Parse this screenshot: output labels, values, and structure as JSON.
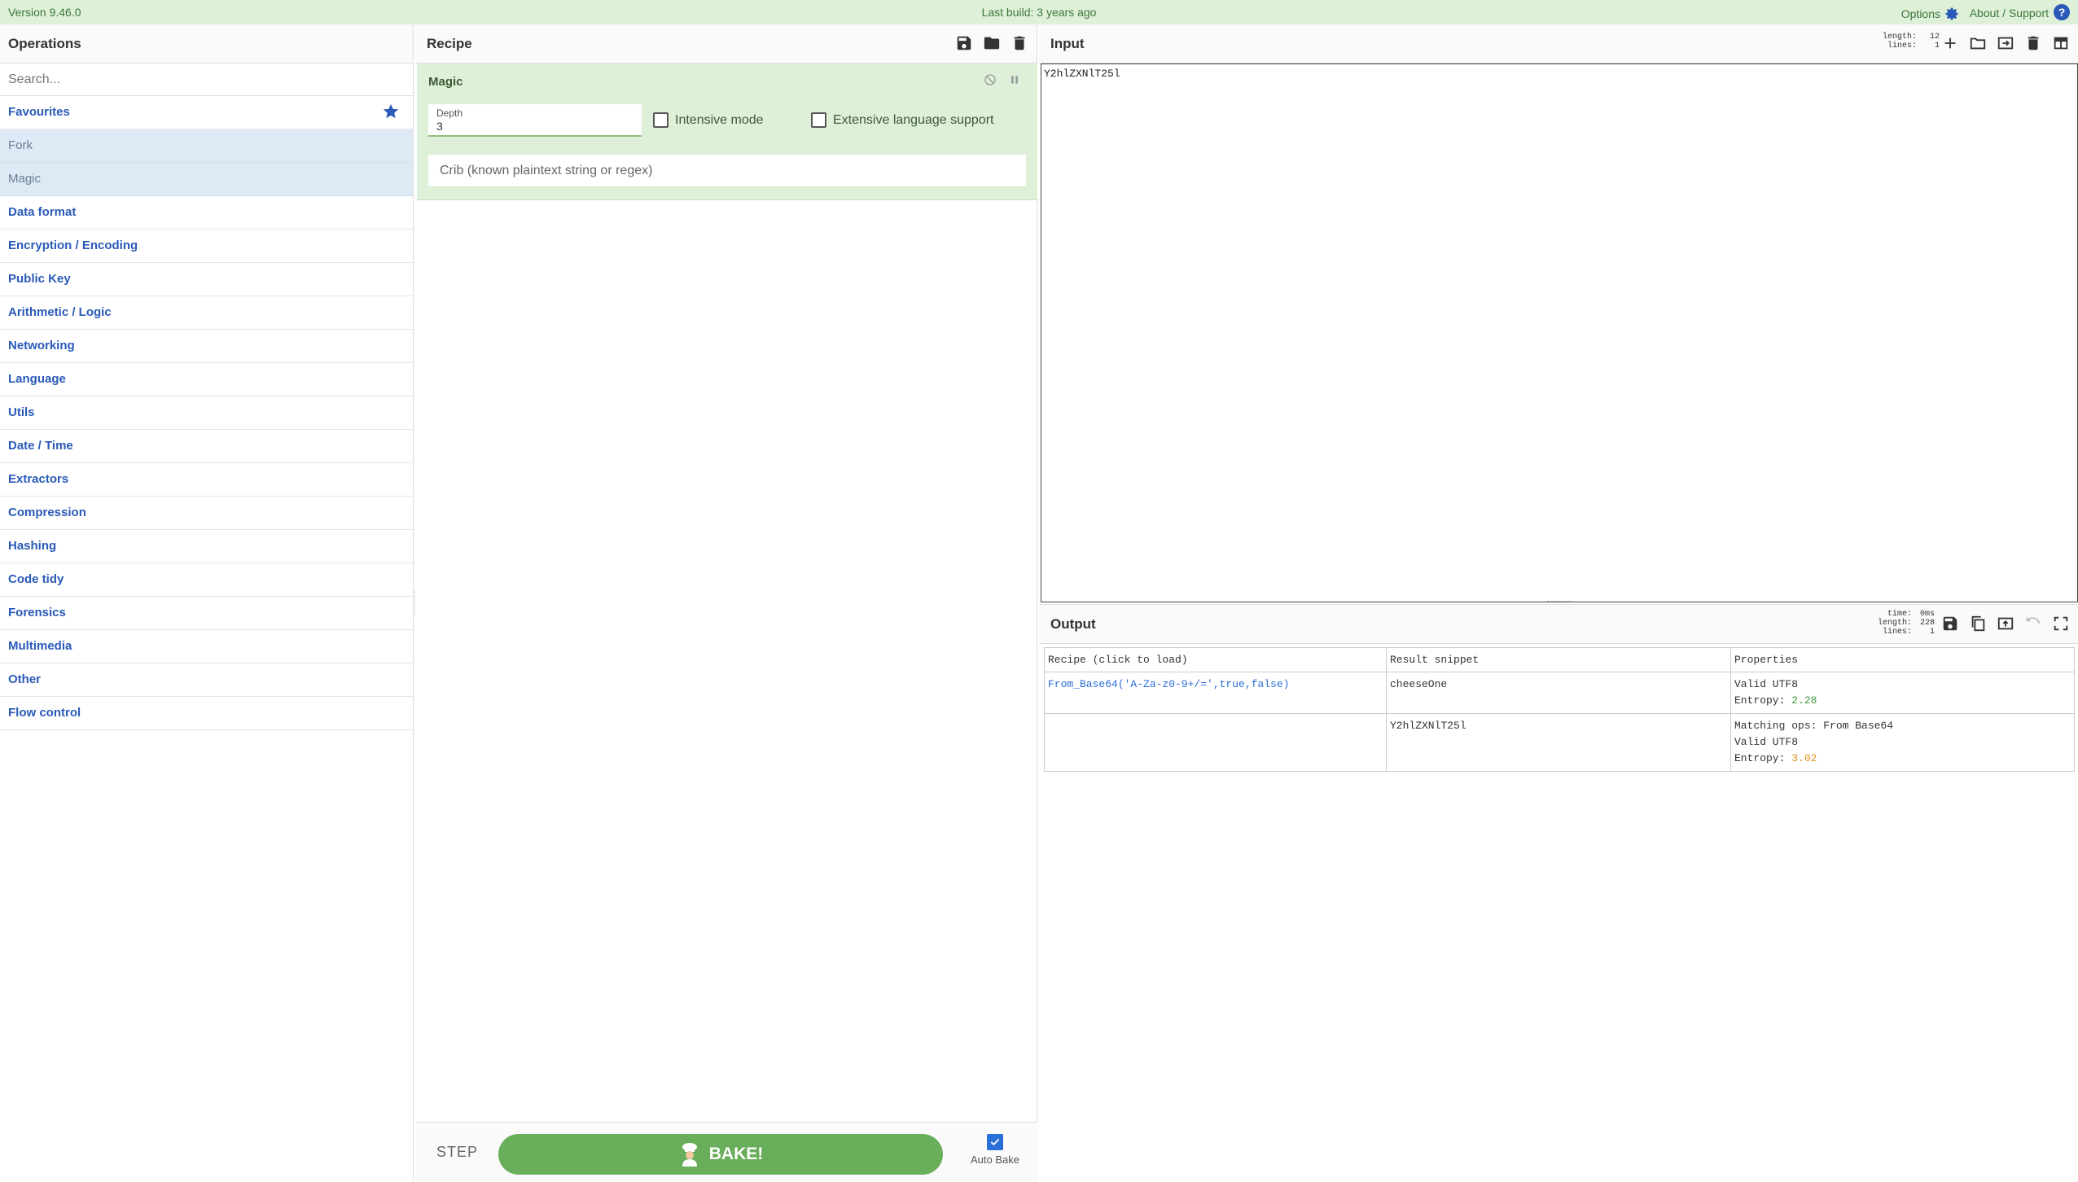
{
  "banner": {
    "version": "Version 9.46.0",
    "last_build": "Last build: 3 years ago",
    "options": "Options",
    "about": "About / Support",
    "bg_color": "#dff0d8"
  },
  "operations": {
    "title": "Operations",
    "search_placeholder": "Search...",
    "favourites": "Favourites",
    "favourite_items": [
      "Fork",
      "Magic"
    ],
    "categories": [
      "Data format",
      "Encryption / Encoding",
      "Public Key",
      "Arithmetic / Logic",
      "Networking",
      "Language",
      "Utils",
      "Date / Time",
      "Extractors",
      "Compression",
      "Hashing",
      "Code tidy",
      "Forensics",
      "Multimedia",
      "Other",
      "Flow control"
    ]
  },
  "recipe": {
    "title": "Recipe",
    "operation": {
      "name": "Magic",
      "depth_label": "Depth",
      "depth_value": "3",
      "intensive_mode": "Intensive mode",
      "extensive_language": "Extensive language support",
      "crib_placeholder": "Crib (known plaintext string or regex)"
    },
    "step": "STEP",
    "bake": "BAKE!",
    "auto_bake": "Auto Bake",
    "auto_bake_checked": true
  },
  "input": {
    "title": "Input",
    "stats": {
      "length_label": "length:",
      "length": "12",
      "lines_label": "lines:",
      "lines": "1"
    },
    "value": "Y2hlZXNlT25l"
  },
  "output": {
    "title": "Output",
    "stats": {
      "time_label": "time:",
      "time": "0ms",
      "length_label": "length:",
      "length": "228",
      "lines_label": "lines:",
      "lines": "1"
    },
    "table": {
      "headers": [
        "Recipe (click to load)",
        "Result snippet",
        "Properties"
      ],
      "rows": [
        {
          "recipe": "From_Base64('A-Za-z0-9+/=',true,false)",
          "snippet": "cheeseOne",
          "props": [
            "Valid UTF8"
          ],
          "entropy_label": "Entropy:",
          "entropy": "2.28"
        },
        {
          "recipe": "",
          "snippet": "Y2hlZXNlT25l",
          "props": [
            "Matching ops: From Base64",
            "Valid UTF8"
          ],
          "entropy_label": "Entropy:",
          "entropy": "3.02"
        }
      ]
    }
  }
}
